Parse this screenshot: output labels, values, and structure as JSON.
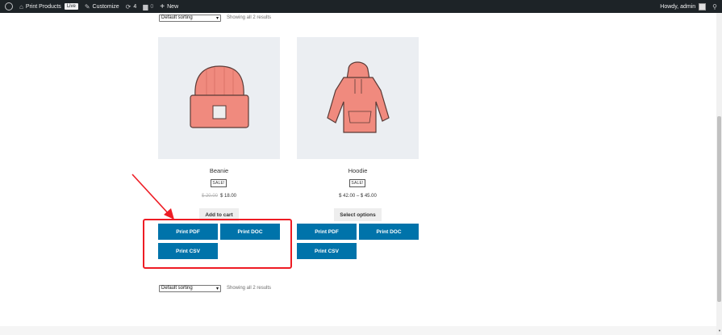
{
  "adminbar": {
    "site_name": "Print Products",
    "live_badge": "Live",
    "customize": "Customize",
    "updates_count": "4",
    "comments_count": "0",
    "new_label": "New",
    "howdy": "Howdy, admin"
  },
  "toolbar_top": {
    "sorting": "Default sorting",
    "result_count": "Showing all 2 results"
  },
  "toolbar_bottom": {
    "sorting": "Default sorting",
    "result_count": "Showing all 2 results"
  },
  "products": [
    {
      "title": "Beanie",
      "sale_badge": "SALE!",
      "price_old": "$ 20.00",
      "price_new": "$ 18.00",
      "action": "Add to cart",
      "print_pdf": "Print PDF",
      "print_doc": "Print DOC",
      "print_csv": "Print CSV"
    },
    {
      "title": "Hoodie",
      "sale_badge": "SALE!",
      "price_range": "$ 42.00 – $ 45.00",
      "action": "Select options",
      "print_pdf": "Print PDF",
      "print_doc": "Print DOC",
      "print_csv": "Print CSV"
    }
  ],
  "colors": {
    "adminbar_bg": "#1d2327",
    "button_blue": "#0073aa",
    "highlight_red": "#ee1c24",
    "product_illustration": "#f08a7e",
    "image_bg": "#ebeef2"
  }
}
